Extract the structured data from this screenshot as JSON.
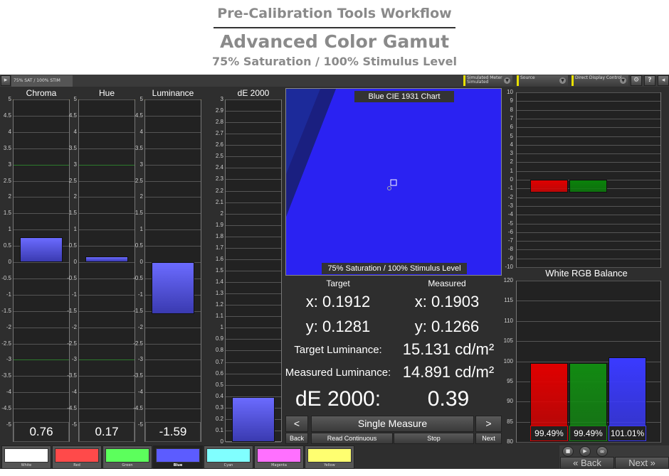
{
  "header": {
    "workflow": "Pre-Calibration Tools Workflow",
    "title": "Advanced Color Gamut",
    "subtitle": "75% Saturation / 100% Stimulus Level"
  },
  "toolbar": {
    "tab": "75% SAT / 100% STIM",
    "meter": "Simulated Meter",
    "meter_sub": "Simulated",
    "source": "Source",
    "display": "Direct Display Control",
    "icons": [
      "gear-icon",
      "help-icon",
      "collapse-icon"
    ]
  },
  "gauges": [
    {
      "label": "Chroma",
      "value": 0.76,
      "display": "0.76",
      "min": -5,
      "max": 5,
      "step": 0.5
    },
    {
      "label": "Hue",
      "value": 0.17,
      "display": "0.17",
      "min": -5,
      "max": 5,
      "step": 0.5
    },
    {
      "label": "Luminance",
      "value": -1.59,
      "display": "-1.59",
      "min": -5,
      "max": 5,
      "step": 0.5
    },
    {
      "label": "dE 2000",
      "value": 0.39,
      "display": "",
      "min": 0,
      "max": 3,
      "step": 0.1
    }
  ],
  "cie": {
    "title": "Blue CIE 1931 Chart",
    "caption": "75% Saturation / 100% Stimulus Level",
    "bg": "#2a22f2"
  },
  "readout": {
    "target_label": "Target",
    "measured_label": "Measured",
    "target_x": "x: 0.1912",
    "target_y": "y: 0.1281",
    "measured_x": "x: 0.1903",
    "measured_y": "y: 0.1266",
    "target_lum_label": "Target Luminance:",
    "target_lum": "15.131 cd/m²",
    "measured_lum_label": "Measured Luminance:",
    "measured_lum": "14.891 cd/m²",
    "de_label": "dE 2000:",
    "de_value": "0.39"
  },
  "controls": {
    "prev": "<",
    "single": "Single Measure",
    "next_arrow": ">",
    "back": "Back",
    "read_continuous": "Read Continuous",
    "stop": "Stop",
    "next": "Next"
  },
  "rgb_error": {
    "min": -10,
    "max": 10,
    "red": -1.5,
    "green": -1.5,
    "blue": 0
  },
  "rgb_balance": {
    "title": "White RGB Balance",
    "min": 80,
    "max": 120,
    "step": 5,
    "bars": [
      {
        "color": "#e00000",
        "value": 99.49,
        "label": "99.49%"
      },
      {
        "color": "#128a12",
        "value": 99.49,
        "label": "99.49%"
      },
      {
        "color": "#3a3aff",
        "value": 101.01,
        "label": "101.01%"
      }
    ]
  },
  "swatches": [
    {
      "label": "White",
      "color": "#ffffff"
    },
    {
      "label": "Red",
      "color": "#ff4a4a"
    },
    {
      "label": "Green",
      "color": "#5cff5c"
    },
    {
      "label": "Blue",
      "color": "#5c5cff",
      "selected": true
    },
    {
      "label": "Cyan",
      "color": "#80ffff"
    },
    {
      "label": "Magenta",
      "color": "#ff70ff"
    },
    {
      "label": "Yellow",
      "color": "#ffff70"
    }
  ],
  "nav": {
    "back": "Back",
    "next": "Next",
    "icons": [
      "stop-icon",
      "play-icon",
      "loop-icon"
    ]
  }
}
